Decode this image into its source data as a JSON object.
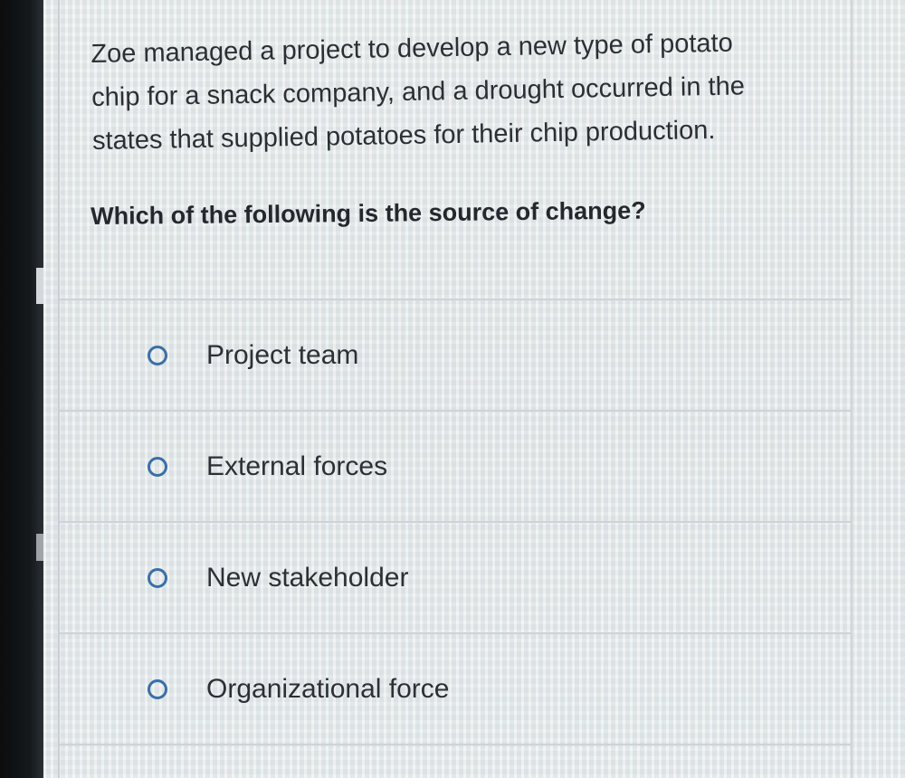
{
  "question": {
    "lines": [
      "Zoe managed a project to develop a new type of potato",
      "chip for a snack company, and a drought occurred in the",
      "states that supplied potatoes for their chip production."
    ],
    "prompt": "Which of the following is the source of change?"
  },
  "options": [
    {
      "label": "Project team",
      "icon": "radio-unselected-icon"
    },
    {
      "label": "External forces",
      "icon": "radio-unselected-icon"
    },
    {
      "label": "New stakeholder",
      "icon": "radio-unselected-icon"
    },
    {
      "label": "Organizational force",
      "icon": "radio-unselected-icon"
    }
  ],
  "colors": {
    "radio_border": "#3a6fa8",
    "text": "#2c3034",
    "divider": "#cdd3d6"
  }
}
